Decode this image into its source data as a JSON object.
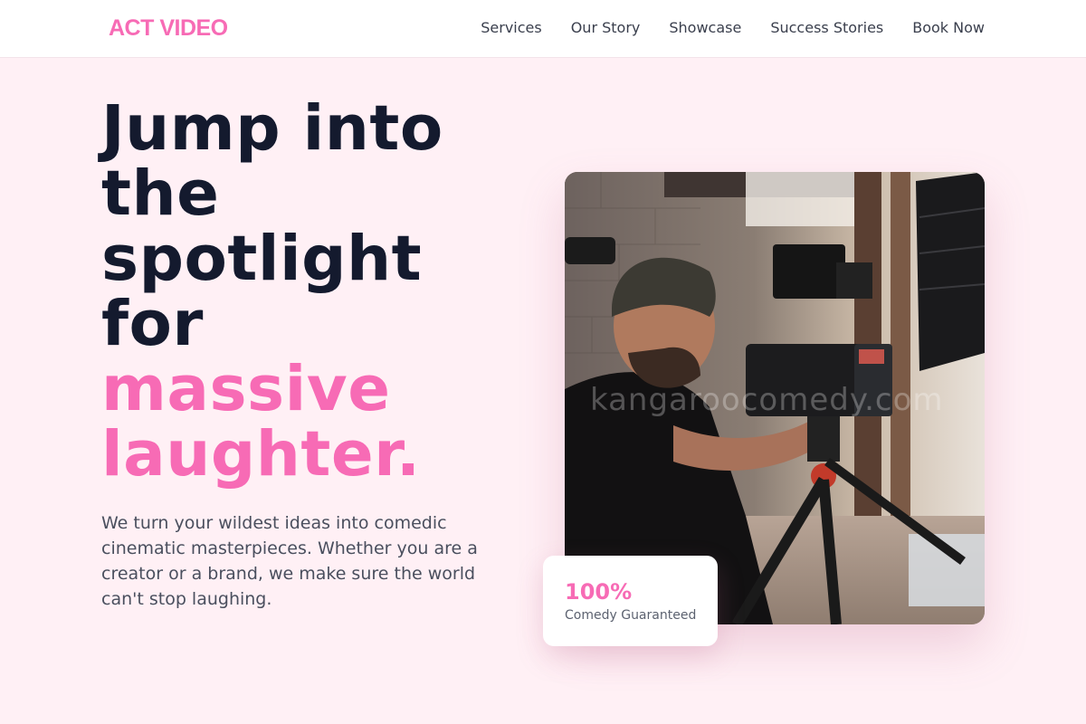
{
  "brand": {
    "name": "ACT VIDEO",
    "color": "#f76bb5"
  },
  "nav": {
    "items": [
      {
        "label": "Services"
      },
      {
        "label": "Our Story"
      },
      {
        "label": "Showcase"
      },
      {
        "label": "Success Stories"
      },
      {
        "label": "Book Now"
      }
    ]
  },
  "hero": {
    "headline_lines": [
      "Jump into",
      "the",
      "spotlight",
      "for"
    ],
    "headline_accent_lines": [
      "massive",
      "laughter."
    ],
    "description": "We turn your wildest ideas into comedic cinematic masterpieces. Whether you are a creator or a brand, we make sure the world can't stop laughing.",
    "image": {
      "watermark": "kangaroocomedy.com",
      "subject": "camera-operator-photo"
    }
  },
  "stat": {
    "value": "100%",
    "label": "Comedy Guaranteed"
  },
  "colors": {
    "accent": "#f76bb5",
    "background": "#fff0f5",
    "text": "#141a2e"
  }
}
